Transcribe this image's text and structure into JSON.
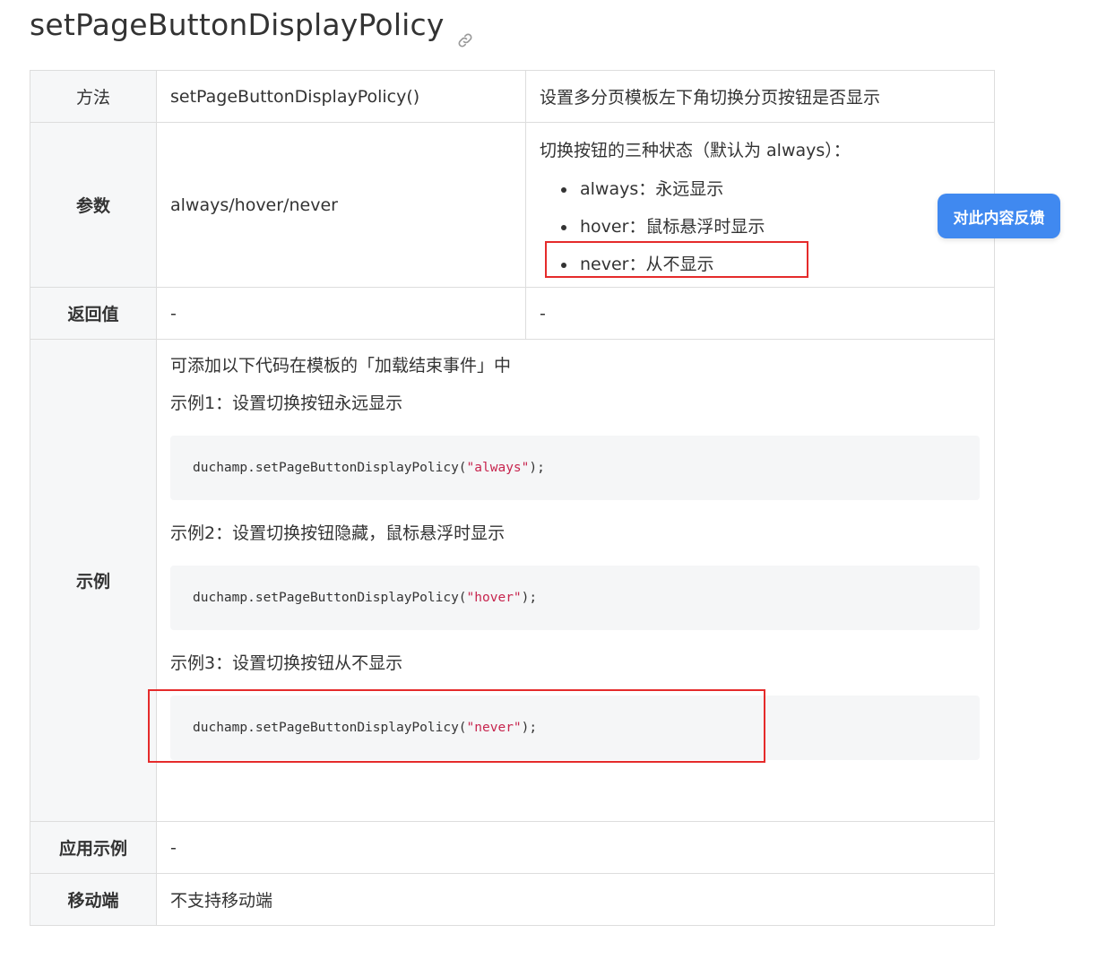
{
  "title": "setPageButtonDisplayPolicy",
  "table": {
    "method": {
      "label": "方法",
      "value": "setPageButtonDisplayPolicy()",
      "desc": "设置多分页模板左下角切换分页按钮是否显示"
    },
    "params": {
      "label": "参数",
      "value": "always/hover/never",
      "desc_title": "切换按钮的三种状态（默认为 always）：",
      "states": [
        "always：永远显示",
        "hover：鼠标悬浮时显示",
        "never：从不显示"
      ]
    },
    "return": {
      "label": "返回值",
      "value": "-",
      "desc": "-"
    },
    "example": {
      "label": "示例",
      "intro": "可添加以下代码在模板的「加载结束事件」中",
      "items": [
        {
          "caption": "示例1：设置切换按钮永远显示",
          "code_prefix": "duchamp.setPageButtonDisplayPolicy(",
          "code_arg": "\"always\"",
          "code_suffix": ");"
        },
        {
          "caption": "示例2：设置切换按钮隐藏，鼠标悬浮时显示",
          "code_prefix": "duchamp.setPageButtonDisplayPolicy(",
          "code_arg": "\"hover\"",
          "code_suffix": ");"
        },
        {
          "caption": "示例3：设置切换按钮从不显示",
          "code_prefix": "duchamp.setPageButtonDisplayPolicy(",
          "code_arg": "\"never\"",
          "code_suffix": ");"
        }
      ]
    },
    "app_example": {
      "label": "应用示例",
      "value": "-"
    },
    "mobile": {
      "label": "移动端",
      "value": "不支持移动端"
    }
  },
  "feedback_button": "对此内容反馈",
  "colors": {
    "accent": "#4089f0",
    "highlight": "#e52b2b",
    "code_string": "#c7254e"
  }
}
